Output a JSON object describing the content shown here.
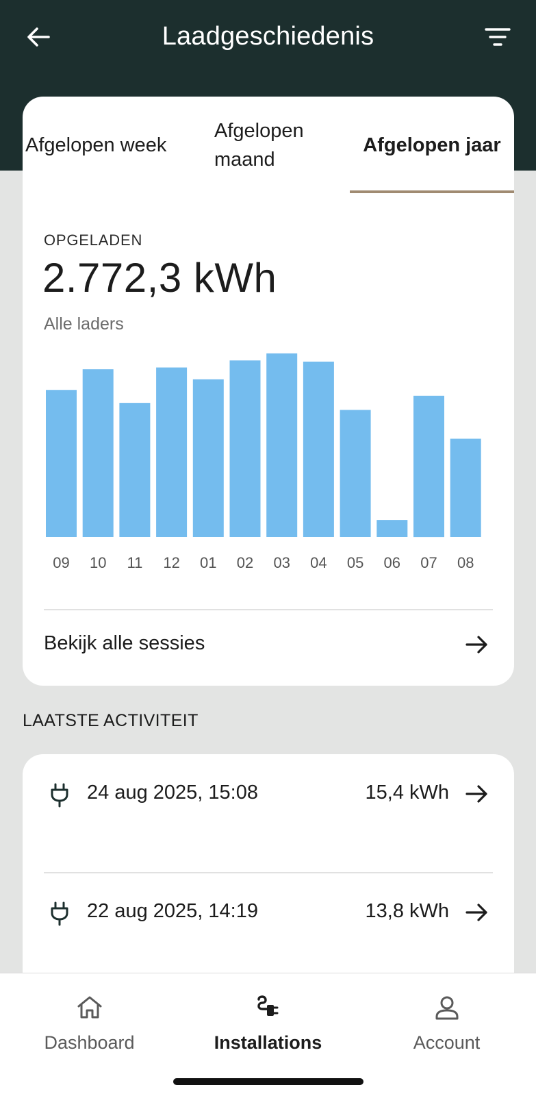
{
  "header": {
    "title": "Laadgeschiedenis",
    "back_icon": "arrow-left-icon",
    "filter_icon": "filter-icon"
  },
  "tabs": [
    {
      "label": "Afgelopen week",
      "active": false
    },
    {
      "label": "Afgelopen maand",
      "active": false
    },
    {
      "label": "Afgelopen jaar",
      "active": true
    }
  ],
  "summary": {
    "label": "OPGELADEN",
    "value": "2.772,3 kWh",
    "scope": "Alle laders"
  },
  "chart_data": {
    "type": "bar",
    "categories": [
      "09",
      "10",
      "11",
      "12",
      "01",
      "02",
      "03",
      "04",
      "05",
      "06",
      "07",
      "08"
    ],
    "values": [
      250,
      285,
      228,
      288,
      268,
      300,
      312,
      298,
      216,
      29,
      240,
      167
    ],
    "ylim": [
      0,
      320
    ],
    "grid": false,
    "title": "",
    "xlabel": "",
    "ylabel": "",
    "bar_color": "#74bcee"
  },
  "sessions_link": {
    "label": "Bekijk alle sessies"
  },
  "activity": {
    "title": "LAATSTE ACTIVITEIT",
    "items": [
      {
        "date": "24 aug 2025, 15:08",
        "energy": "15,4 kWh"
      },
      {
        "date": "22 aug 2025, 14:19",
        "energy": "13,8 kWh"
      }
    ]
  },
  "nav": {
    "items": [
      {
        "label": "Dashboard",
        "icon": "home-icon",
        "active": false
      },
      {
        "label": "Installations",
        "icon": "plug-charger-icon",
        "active": true
      },
      {
        "label": "Account",
        "icon": "user-icon",
        "active": false
      }
    ]
  },
  "colors": {
    "header_bg": "#1c2f2e",
    "page_bg": "#e3e4e3",
    "tab_underline": "#a08b72",
    "bar": "#74bcee"
  }
}
